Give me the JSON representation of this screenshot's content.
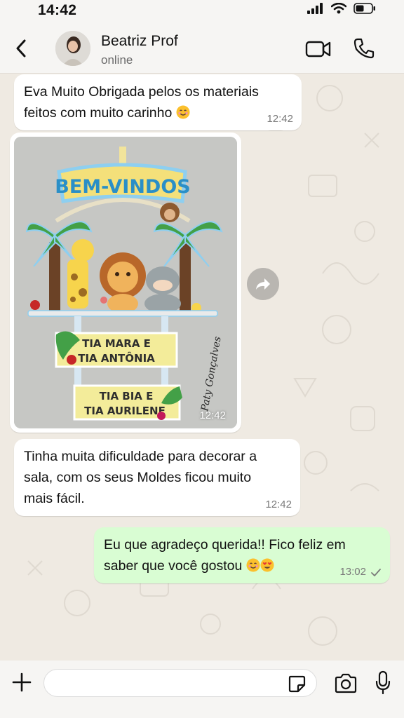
{
  "status_bar": {
    "time": "14:42"
  },
  "header": {
    "contact_name": "Beatriz Prof",
    "contact_status": "online"
  },
  "messages": [
    {
      "direction": "in",
      "text_line1": "Eva Muito Obrigada pelos os materiais",
      "text_line2": "feitos com muito carinho",
      "emoji": "smiling-face-icon",
      "time": "12:42"
    },
    {
      "direction": "in",
      "type": "image",
      "time": "12:42",
      "image": {
        "sign_title": "BEM-VINDOS",
        "plaque1_line1": "TIA MARA E",
        "plaque1_line2": "TIA ANTÔNIA",
        "plaque2_line1": "TIA BIA E",
        "plaque2_line2": "TIA AURILENE",
        "signature": "Paty Gonçalves"
      }
    },
    {
      "direction": "in",
      "text_line1": "Tinha muita dificuldade para decorar a",
      "text_line2": "sala, com os seus Moldes ficou muito",
      "text_line3": "mais fácil.",
      "time": "12:42"
    },
    {
      "direction": "out",
      "text_line1": "Eu que agradeço querida!! Fico feliz em",
      "text_line2": "saber que você gostou",
      "emojis": [
        "smiling-face-icon",
        "heart-eyes-icon"
      ],
      "time": "13:02",
      "status": "sent"
    }
  ],
  "colors": {
    "background": "#efeae2",
    "incoming": "#ffffff",
    "outgoing": "#d9fdd3",
    "bars": "#f6f5f3"
  }
}
